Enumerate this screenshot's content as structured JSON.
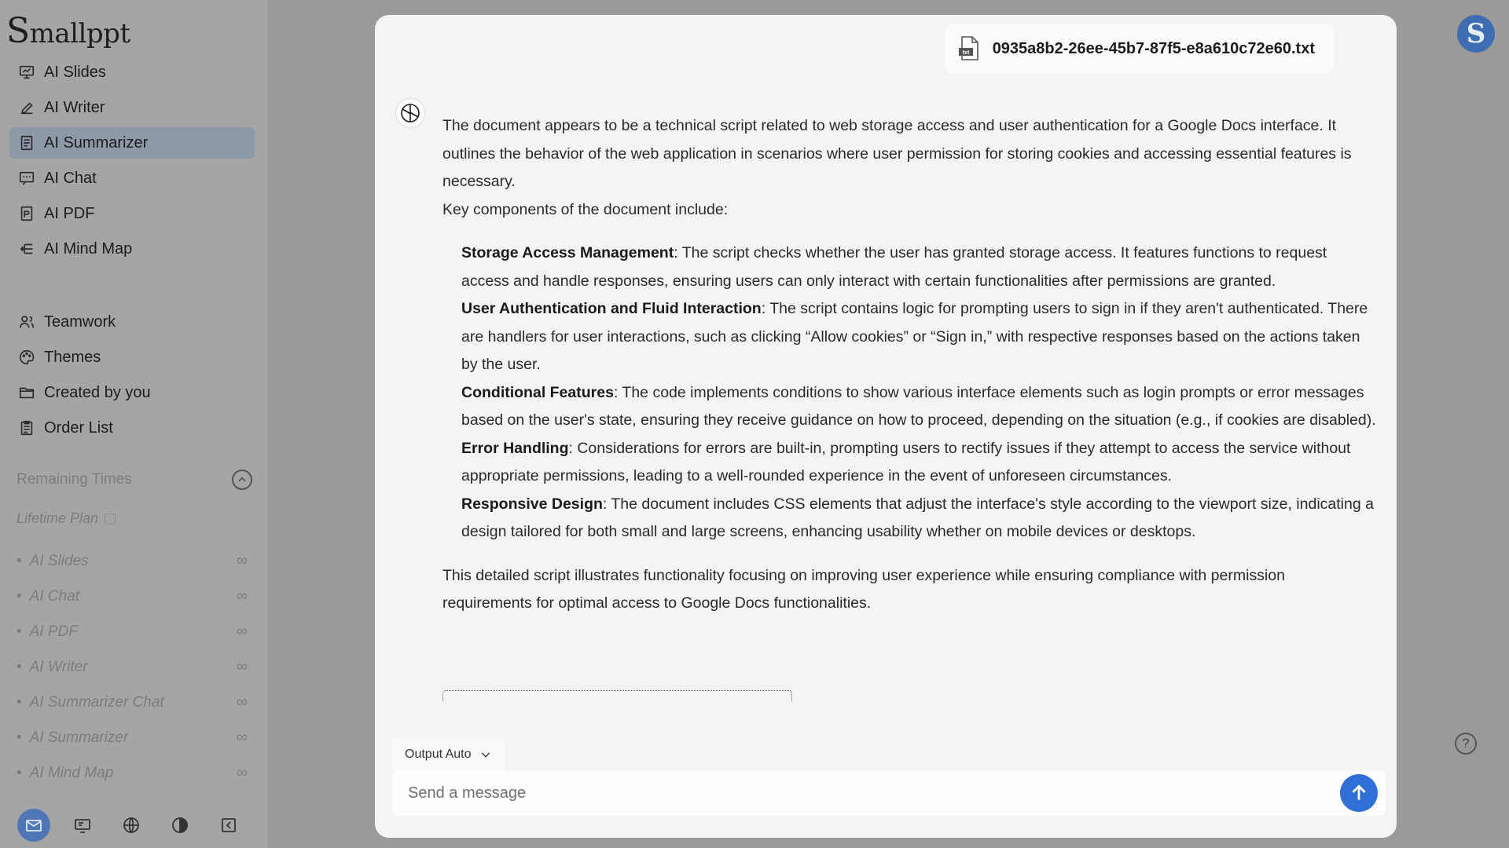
{
  "app": {
    "logo_initial": "S",
    "logo_rest": "mallppt"
  },
  "sidebar": {
    "primary_items": [
      {
        "label": "AI Slides",
        "icon": "presentation-icon"
      },
      {
        "label": "AI Writer",
        "icon": "pen-icon"
      },
      {
        "label": "AI Summarizer",
        "icon": "document-icon",
        "active": true
      },
      {
        "label": "AI Chat",
        "icon": "chat-icon"
      },
      {
        "label": "AI PDF",
        "icon": "pdf-icon"
      },
      {
        "label": "AI Mind Map",
        "icon": "mindmap-icon"
      }
    ],
    "secondary_items": [
      {
        "label": "Teamwork",
        "icon": "team-icon"
      },
      {
        "label": "Themes",
        "icon": "palette-icon"
      },
      {
        "label": "Created by you",
        "icon": "folder-icon"
      },
      {
        "label": "Order List",
        "icon": "clipboard-icon"
      }
    ],
    "remaining_title": "Remaining Times",
    "plan_label": "Lifetime Plan",
    "quota": [
      {
        "label": "AI Slides",
        "value": "∞"
      },
      {
        "label": "AI Chat",
        "value": "∞"
      },
      {
        "label": "AI PDF",
        "value": "∞"
      },
      {
        "label": "AI Writer",
        "value": "∞"
      },
      {
        "label": "AI Summarizer Chat",
        "value": "∞"
      },
      {
        "label": "AI Summarizer",
        "value": "∞"
      },
      {
        "label": "AI Mind Map",
        "value": "∞"
      }
    ],
    "bottom_icons": [
      "mail-icon",
      "slides-preview-icon",
      "globe-icon",
      "contrast-icon",
      "collapse-sidebar-icon"
    ]
  },
  "file": {
    "name": "0935a8b2-26ee-45b7-87f5-e8a610c72e60.txt",
    "type_label": "txt"
  },
  "message": {
    "intro": "The document appears to be a technical script related to web storage access and user authentication for a Google Docs interface. It outlines the behavior of the web application in scenarios where user permission for storing cookies and accessing essential features is necessary.",
    "components_heading": "Key components of the document include:",
    "components": [
      {
        "title": "Storage Access Management",
        "text": ": The script checks whether the user has granted storage access. It features functions to request access and handle responses, ensuring users can only interact with certain functionalities after permissions are granted."
      },
      {
        "title": "User Authentication and Fluid Interaction",
        "text": ": The script contains logic for prompting users to sign in if they aren't authenticated. There are handlers for user interactions, such as clicking “Allow cookies” or “Sign in,” with respective responses based on the actions taken by the user."
      },
      {
        "title": "Conditional Features",
        "text": ": The code implements conditions to show various interface elements such as login prompts or error messages based on the user's state, ensuring they receive guidance on how to proceed, depending on the situation (e.g., if cookies are disabled)."
      },
      {
        "title": "Error Handling",
        "text": ": Considerations for errors are built-in, prompting users to rectify issues if they attempt to access the service without appropriate permissions, leading to a well-rounded experience in the event of unforeseen circumstances."
      },
      {
        "title": "Responsive Design",
        "text": ": The document includes CSS elements that adjust the interface's style according to the viewport size, indicating a design tailored for both small and large screens, enhancing usability whether on mobile devices or desktops."
      }
    ],
    "conclusion": "This detailed script illustrates functionality focusing on improving user experience while ensuring compliance with permission requirements for optimal access to Google Docs functionalities."
  },
  "composer": {
    "output_label": "Output Auto",
    "placeholder": "Send a message"
  },
  "user": {
    "avatar_initial": "S"
  },
  "help": {
    "glyph": "?"
  },
  "colors": {
    "accent": "#2f6fd6",
    "active_nav": "#8e99a8",
    "avatar": "#3e6db1"
  }
}
